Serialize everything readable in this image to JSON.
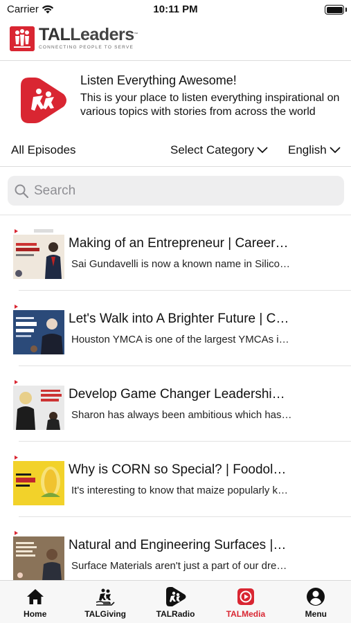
{
  "status_bar": {
    "carrier": "Carrier",
    "time": "10:11 PM"
  },
  "header": {
    "logo_prefix": "TAL",
    "logo_suffix": "Leaders",
    "logo_tm": "™",
    "logo_tagline": "CONNECTING PEOPLE TO SERVE"
  },
  "intro": {
    "title": "Listen Everything Awesome!",
    "body": "This is your place to listen everything inspirational on various topics with stories from across the world"
  },
  "filters": {
    "all_episodes": "All Episodes",
    "category": "Select Category",
    "language": "English"
  },
  "search": {
    "placeholder": "Search"
  },
  "episodes": [
    {
      "title": "Making of an Entrepreneur | Career…",
      "desc": "Sai Gundavelli is now a known name in Silico…"
    },
    {
      "title": "Let's Walk into A Brighter Future | C…",
      "desc": "Houston YMCA is one of the largest YMCAs i…"
    },
    {
      "title": "Develop Game Changer Leadershi…",
      "desc": "Sharon has always been ambitious which has…"
    },
    {
      "title": "Why is CORN so Special? | Foodol…",
      "desc": "It's interesting to know that maize popularly k…"
    },
    {
      "title": "Natural and Engineering Surfaces |…",
      "desc": "Surface Materials aren't just a part of our dre…"
    }
  ],
  "tabs": [
    {
      "label": "Home",
      "icon": "home-icon"
    },
    {
      "label": "TALGiving",
      "icon": "giving-icon"
    },
    {
      "label": "TALRadio",
      "icon": "radio-icon"
    },
    {
      "label": "TALMedia",
      "icon": "media-icon",
      "active": true
    },
    {
      "label": "Menu",
      "icon": "user-icon"
    }
  ],
  "colors": {
    "brand_red": "#d92632",
    "active_tab": "#d92632"
  }
}
